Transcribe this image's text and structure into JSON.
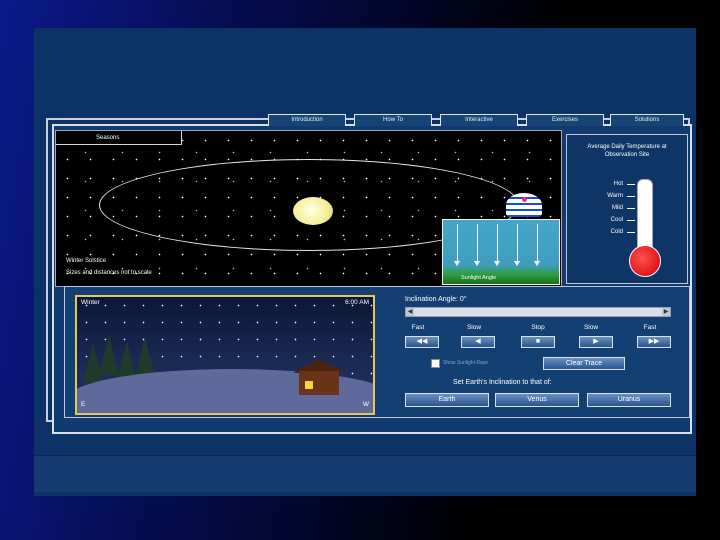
{
  "tabs": [
    "Introduction",
    "How To",
    "Interactive",
    "Exercises",
    "Solutions"
  ],
  "orbit_panel": {
    "title": "Seasons",
    "caption_line1": "Winter Solstice",
    "caption_line2": "Sizes and distances not to scale",
    "sunlight_label": "Sunlight Angle"
  },
  "thermometer": {
    "title": "Average Daily Temperature at Observation Site",
    "levels": [
      "Hot",
      "Warm",
      "Mild",
      "Cool",
      "Cold"
    ],
    "fill_fraction": 0.15
  },
  "scene": {
    "season": "Winter",
    "time": "6:00 AM",
    "left_dir": "E",
    "right_dir": "W"
  },
  "controls": {
    "inclination_label": "Inclination Angle: 0°",
    "speed_labels": [
      "Fast",
      "Slow",
      "Stop",
      "Slow",
      "Fast"
    ],
    "speed_icons": [
      "◀◀",
      "◀",
      "■",
      "▶",
      "▶▶"
    ],
    "show_sunlight_label": "Show Sunlight Rays",
    "clear_trace": "Clear Trace",
    "set_label": "Set Earth's Inclination to that of:",
    "planet_buttons": [
      "Earth",
      "Venus",
      "Uranus"
    ]
  }
}
